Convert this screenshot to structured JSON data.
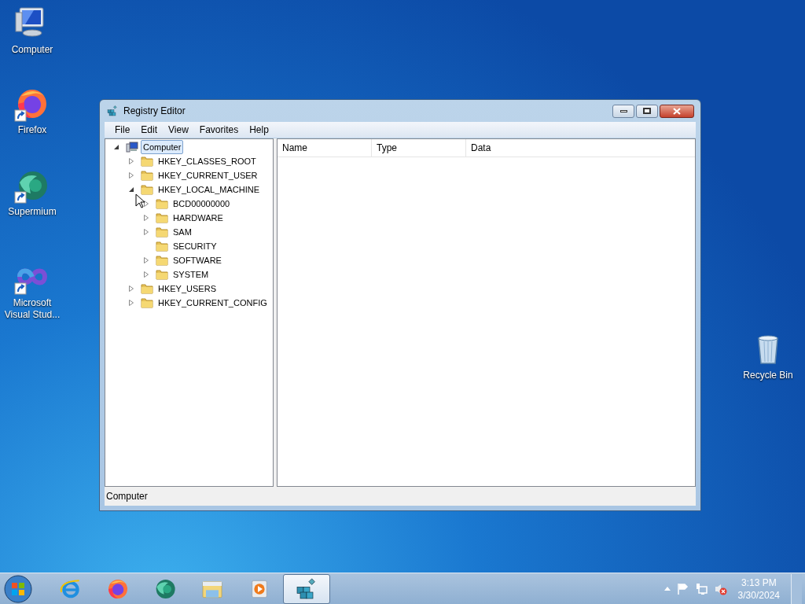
{
  "desktop_icons": [
    {
      "kind": "computer",
      "label": "Computer"
    },
    {
      "kind": "firefox",
      "label": "Firefox"
    },
    {
      "kind": "supermium",
      "label": "Supermium"
    },
    {
      "kind": "visualstudio",
      "label": "Microsoft Visual Stud..."
    },
    {
      "kind": "recyclebin",
      "label": "Recycle Bin"
    }
  ],
  "window": {
    "title": "Registry Editor",
    "menu": [
      "File",
      "Edit",
      "View",
      "Favorites",
      "Help"
    ],
    "tree": [
      {
        "kind": "computer",
        "label": "Computer",
        "expandable": true,
        "expanded": true,
        "selected": true,
        "children": [
          {
            "kind": "folder",
            "label": "HKEY_CLASSES_ROOT",
            "expandable": true,
            "expanded": false,
            "selected": false
          },
          {
            "kind": "folder",
            "label": "HKEY_CURRENT_USER",
            "expandable": true,
            "expanded": false,
            "selected": false
          },
          {
            "kind": "folder",
            "label": "HKEY_LOCAL_MACHINE",
            "expandable": true,
            "expanded": true,
            "selected": false,
            "children": [
              {
                "kind": "folder",
                "label": "BCD00000000",
                "expandable": true,
                "expanded": false,
                "selected": false
              },
              {
                "kind": "folder",
                "label": "HARDWARE",
                "expandable": true,
                "expanded": false,
                "selected": false
              },
              {
                "kind": "folder",
                "label": "SAM",
                "expandable": true,
                "expanded": false,
                "selected": false
              },
              {
                "kind": "folder",
                "label": "SECURITY",
                "expandable": false,
                "selected": false
              },
              {
                "kind": "folder",
                "label": "SOFTWARE",
                "expandable": true,
                "expanded": false,
                "selected": false
              },
              {
                "kind": "folder",
                "label": "SYSTEM",
                "expandable": true,
                "expanded": false,
                "selected": false
              }
            ]
          },
          {
            "kind": "folder",
            "label": "HKEY_USERS",
            "expandable": true,
            "expanded": false,
            "selected": false
          },
          {
            "kind": "folder",
            "label": "HKEY_CURRENT_CONFIG",
            "expandable": true,
            "expanded": false,
            "selected": false
          }
        ]
      }
    ],
    "columns": [
      "Name",
      "Type",
      "Data"
    ],
    "status_bar": "Computer"
  },
  "taskbar": {
    "items": [
      {
        "kind": "ie",
        "selected": false
      },
      {
        "kind": "firefox",
        "selected": false
      },
      {
        "kind": "supermium",
        "selected": false
      },
      {
        "kind": "explorer",
        "selected": false
      },
      {
        "kind": "mediaplayer",
        "selected": false
      },
      {
        "kind": "regedit",
        "selected": true
      }
    ],
    "clock": {
      "time": "3:13 PM",
      "date": "3/30/2024"
    }
  }
}
